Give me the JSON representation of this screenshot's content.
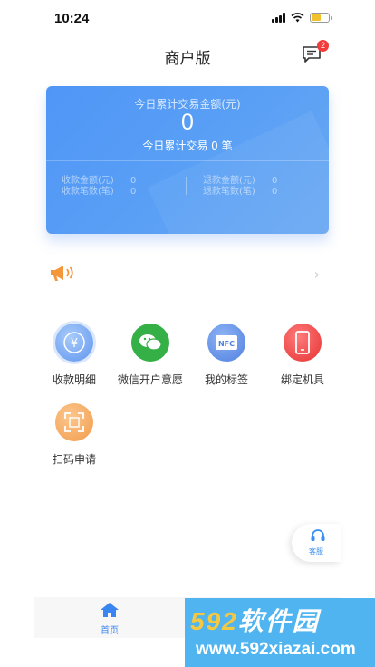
{
  "status_bar": {
    "time": "10:24",
    "battery_level": 0.55,
    "battery_color": "#f1c12d"
  },
  "nav": {
    "title": "商户版",
    "message_badge": "2",
    "message_icon": "message-icon"
  },
  "summary": {
    "amount_label": "今日累计交易金额(元)",
    "amount_value": "0",
    "count_text": "今日累计交易 0 笔",
    "stats": [
      {
        "label": "收款金额(元)",
        "value": "0"
      },
      {
        "label": "收款笔数(笔)",
        "value": "0"
      },
      {
        "label": "退款金额(元)",
        "value": "0"
      },
      {
        "label": "退款笔数(笔)",
        "value": "0"
      }
    ],
    "accent_color": "#4f96f7"
  },
  "notice": {
    "icon": "speaker-icon",
    "chevron": "›"
  },
  "features": [
    {
      "label": "收款明细",
      "icon": "yuan-coin-icon",
      "color": "#6fa6f4"
    },
    {
      "label": "微信开户意愿",
      "icon": "wechat-icon",
      "color": "#34b046"
    },
    {
      "label": "我的标签",
      "icon": "nfc-icon",
      "color": "#5f8fe8"
    },
    {
      "label": "绑定机具",
      "icon": "phone-device-icon",
      "color": "#f04a4a"
    },
    {
      "label": "扫码申请",
      "icon": "scan-icon",
      "color": "#f5a655"
    }
  ],
  "service": {
    "label": "客服"
  },
  "tab_bar": {
    "home_label": "首页"
  },
  "watermark": {
    "brand_num": "592",
    "brand_text": "软件园",
    "url": "www.592xiazai.com"
  }
}
